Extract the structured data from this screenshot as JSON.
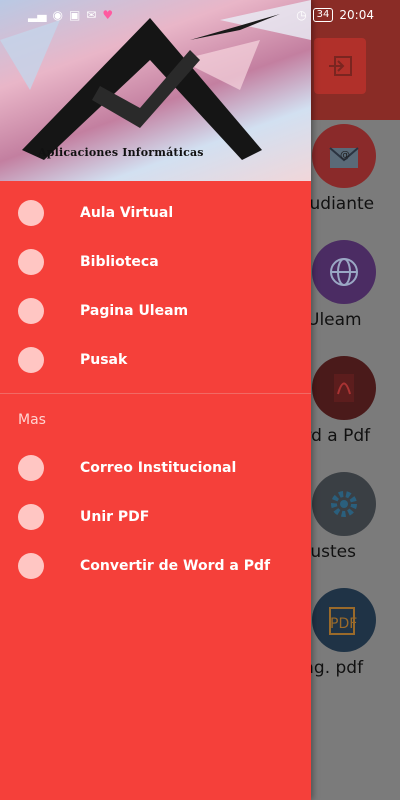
{
  "status_bar": {
    "time": "20:04",
    "battery": "34"
  },
  "drawer": {
    "header_caption": "Aplicaciones Informáticas",
    "items": [
      {
        "label": "Aula Virtual"
      },
      {
        "label": "Biblioteca"
      },
      {
        "label": "Pagina Uleam"
      },
      {
        "label": "Pusak"
      }
    ],
    "section_title": "Mas",
    "more_items": [
      {
        "label": "Correo Institucional"
      },
      {
        "label": "Unir PDF"
      },
      {
        "label": "Convertir de Word a Pdf"
      }
    ]
  },
  "background": {
    "items": [
      {
        "label": "studiante",
        "icon": "email-icon"
      },
      {
        "label": "P.Uleam",
        "icon": "globe-icon"
      },
      {
        "label": "ord a Pdf",
        "icon": "pdf-icon"
      },
      {
        "label": "Ajustes",
        "icon": "gear-icon"
      },
      {
        "label": "Pag. pdf",
        "icon": "pdf-pages-icon"
      }
    ]
  },
  "colors": {
    "drawer": "#f5403a",
    "accent": "#e53935"
  }
}
